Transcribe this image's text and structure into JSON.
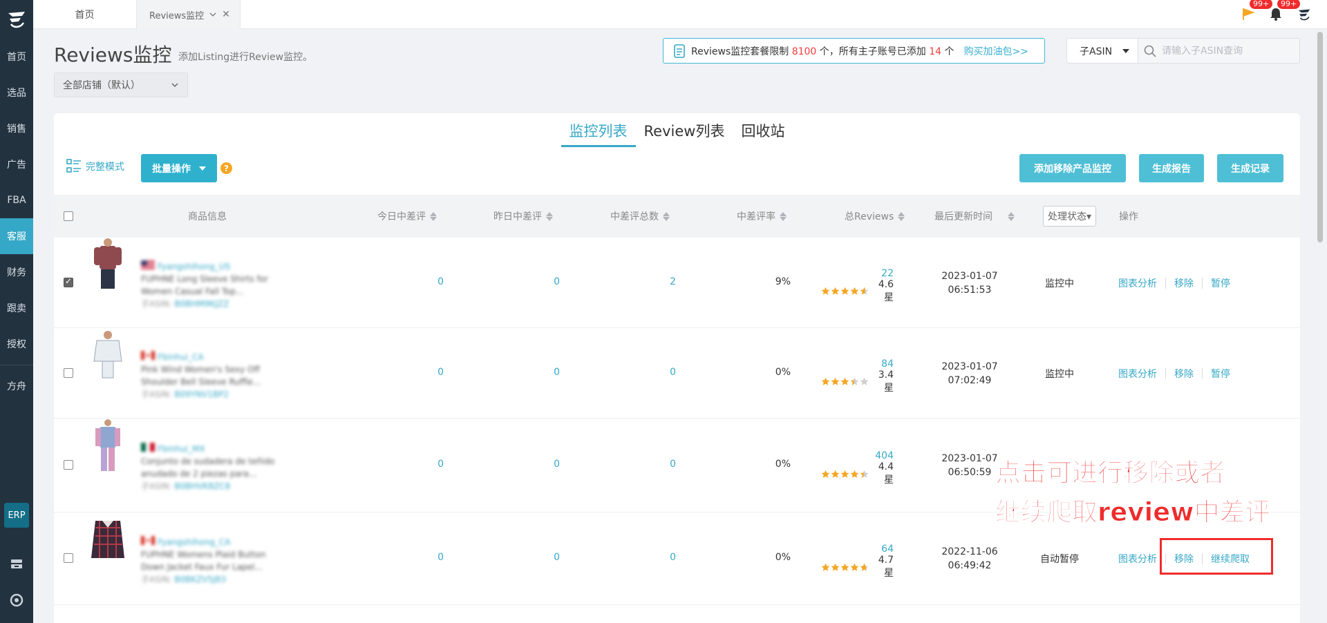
{
  "sidebar": {
    "items": [
      {
        "label": "首页"
      },
      {
        "label": "选品"
      },
      {
        "label": "销售"
      },
      {
        "label": "广告"
      },
      {
        "label": "FBA"
      },
      {
        "label": "客服",
        "active": true
      },
      {
        "label": "财务"
      },
      {
        "label": "跟卖"
      },
      {
        "label": "授权"
      },
      {
        "label": "方舟"
      }
    ],
    "erp_label": "ERP"
  },
  "topbar": {
    "tabs": [
      {
        "label": "首页"
      },
      {
        "label": "Reviews监控"
      }
    ],
    "flag_badge": "99+",
    "bell_badge": "99+"
  },
  "header": {
    "title": "Reviews监控",
    "subtitle": "添加Listing进行Review监控。",
    "store_select": "全部店铺（默认）",
    "notice_prefix": "Reviews监控套餐限制",
    "notice_limit": "8100",
    "notice_mid": "个，所有主子账号已添加",
    "notice_used": "14",
    "notice_suffix": "个",
    "notice_link": "购买加油包>>",
    "asin_type": "子ASIN",
    "asin_placeholder": "请输入子ASIN查询"
  },
  "main": {
    "tabs": [
      "监控列表",
      "Review列表",
      "回收站"
    ],
    "active_tab": 0,
    "mode_label": "完整模式",
    "batch_label": "批量操作",
    "help_glyph": "?",
    "actions": [
      "添加移除产品监控",
      "生成报告",
      "生成记录"
    ]
  },
  "table": {
    "headers": {
      "product": "商品信息",
      "today_neg": "今日中差评",
      "yesterday_neg": "昨日中差评",
      "total_neg": "中差评总数",
      "neg_rate": "中差评率",
      "total_reviews": "总Reviews",
      "last_update": "最后更新时间",
      "status_filter": "处理状态▾",
      "ops": "操作"
    },
    "rows": [
      {
        "checked": true,
        "flag": "US",
        "store": "Fyangshihong_US",
        "title_line1": "FUPHNE Long Sleeve Shirts for",
        "title_line2": "Women Casual Fall Top...",
        "asin_label": "子ASIN:",
        "asin": "B0BHM9KJZZ",
        "today": "0",
        "yesterday": "0",
        "total": "2",
        "rate": "9%",
        "reviews": "22",
        "rating": 4.6,
        "rating_text": "4.6星",
        "date": "2023-01-07",
        "time": "06:51:53",
        "status": "监控中",
        "ops": [
          "图表分析",
          "移除",
          "暂停"
        ]
      },
      {
        "checked": false,
        "flag": "CA",
        "store": "Fbinhui_CA",
        "title_line1": "Pink Wind Women's Sexy Off",
        "title_line2": "Shoulder Bell Sleeve Ruffle...",
        "asin_label": "子ASIN:",
        "asin": "B09YNV1BP2",
        "today": "0",
        "yesterday": "0",
        "total": "0",
        "rate": "0%",
        "reviews": "84",
        "rating": 3.4,
        "rating_text": "3.4星",
        "date": "2023-01-07",
        "time": "07:02:49",
        "status": "监控中",
        "ops": [
          "图表分析",
          "移除",
          "暂停"
        ]
      },
      {
        "checked": false,
        "flag": "MX",
        "store": "Fbinhui_MX",
        "title_line1": "Conjunto de sudadera de teñido",
        "title_line2": "anudado de 2 piezas para...",
        "asin_label": "子ASIN:",
        "asin": "B0BHVK8ZC8",
        "today": "0",
        "yesterday": "0",
        "total": "0",
        "rate": "0%",
        "reviews": "404",
        "rating": 4.4,
        "rating_text": "4.4星",
        "date": "2023-01-07",
        "time": "06:50:59",
        "status": "",
        "ops": []
      },
      {
        "checked": false,
        "flag": "CA",
        "store": "Fyangshihong_CA",
        "title_line1": "FUPHNE Womens Plaid Button",
        "title_line2": "Down Jacket Faux Fur Lapel...",
        "asin_label": "子ASIN:",
        "asin": "B0BKZV5J83",
        "today": "0",
        "yesterday": "0",
        "total": "0",
        "rate": "0%",
        "reviews": "64",
        "rating": 4.7,
        "rating_text": "4.7星",
        "date": "2022-11-06",
        "time": "06:49:42",
        "status": "自动暂停",
        "ops": [
          "图表分析",
          "移除",
          "继续爬取"
        ]
      }
    ]
  },
  "annotation": {
    "line1": "点击可进行移除或者",
    "line2": "继续爬取review中差评"
  },
  "colors": {
    "accent": "#36a8c7",
    "sidebar_bg": "#23323f",
    "annotation_red": "#ef2b2b",
    "badge_red": "#ef2b2b"
  }
}
